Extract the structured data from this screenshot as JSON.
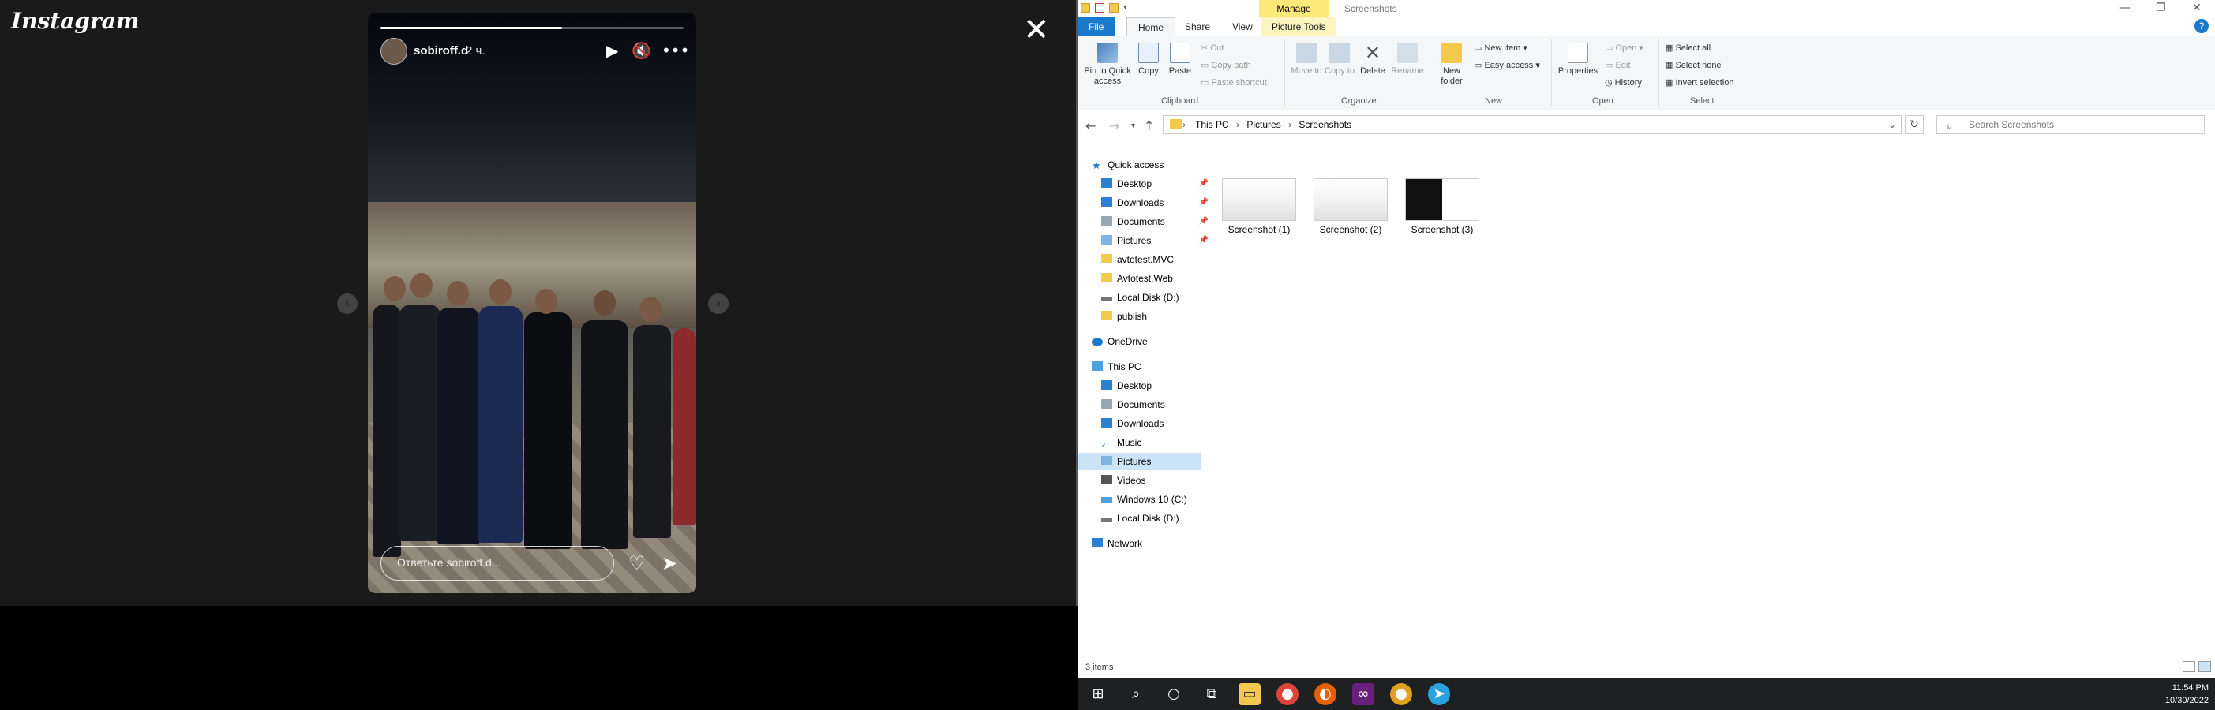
{
  "instagram": {
    "logo": "Instagram",
    "story": {
      "username": "sobiroff.d",
      "time_ago": "2 ч.",
      "progress": 0.6,
      "reply_placeholder": "Ответьте sobiroff.d..."
    },
    "icons": {
      "close": "close-icon",
      "play": "play-icon",
      "mute": "muted-speaker-icon",
      "more": "more-icon",
      "heart": "heart-icon",
      "send": "send-icon",
      "prev": "chevron-left-icon",
      "next": "chevron-right-icon"
    }
  },
  "explorer": {
    "title": "Screenshots",
    "manage_tab": "Manage",
    "tabs": {
      "file": "File",
      "home": "Home",
      "share": "Share",
      "view": "View",
      "picture_tools": "Picture Tools"
    },
    "ribbon": {
      "clipboard": {
        "pin": "Pin to Quick access",
        "copy": "Copy",
        "paste": "Paste",
        "cut": "Cut",
        "copy_path": "Copy path",
        "paste_shortcut": "Paste shortcut",
        "group": "Clipboard"
      },
      "organize": {
        "move_to": "Move to",
        "copy_to": "Copy to",
        "delete": "Delete",
        "rename": "Rename",
        "group": "Organize"
      },
      "new": {
        "new_folder": "New folder",
        "new_item": "New item",
        "easy_access": "Easy access",
        "group": "New"
      },
      "open": {
        "properties": "Properties",
        "open": "Open",
        "edit": "Edit",
        "history": "History",
        "group": "Open"
      },
      "select": {
        "select_all": "Select all",
        "select_none": "Select none",
        "invert": "Invert selection",
        "group": "Select"
      }
    },
    "breadcrumb": [
      "This PC",
      "Pictures",
      "Screenshots"
    ],
    "search_placeholder": "Search Screenshots",
    "nav": {
      "quick_access": "Quick access",
      "qa_items": [
        "Desktop",
        "Downloads",
        "Documents",
        "Pictures",
        "avtotest.MVC",
        "Avtotest.Web",
        "Local Disk (D:)",
        "publish"
      ],
      "onedrive": "OneDrive",
      "this_pc": "This PC",
      "pc_items": [
        "Desktop",
        "Documents",
        "Downloads",
        "Music",
        "Pictures",
        "Videos",
        "Windows 10 (C:)",
        "Local Disk (D:)"
      ],
      "network": "Network"
    },
    "files": [
      "Screenshot (1)",
      "Screenshot (2)",
      "Screenshot (3)"
    ],
    "status": "3 items"
  },
  "taskbar": {
    "time": "11:54 PM",
    "date": "10/30/2022",
    "apps": [
      "windows-start-icon",
      "search-icon",
      "cortana-icon",
      "task-view-icon",
      "file-explorer-icon",
      "chrome-icon",
      "firefox-icon",
      "visual-studio-icon",
      "chrome-canary-icon",
      "telegram-icon"
    ]
  },
  "colors": {
    "accent_blue": "#1979ca",
    "manage_yellow": "#fde97a",
    "selection": "#cce4f7",
    "taskbar": "#1f2022"
  }
}
